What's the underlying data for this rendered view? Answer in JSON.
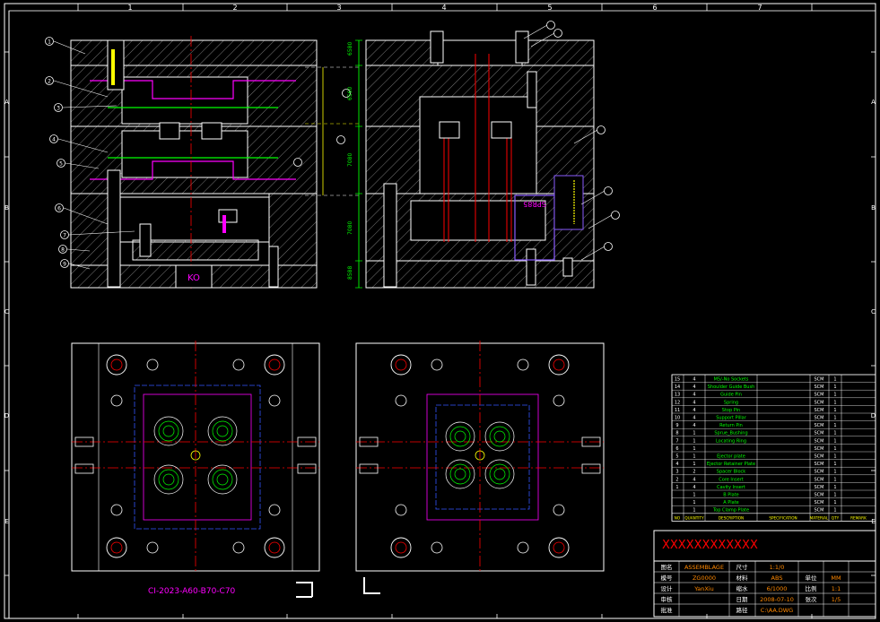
{
  "frame": {
    "col_numbers": [
      "1",
      "2",
      "3",
      "4",
      "5",
      "6",
      "7"
    ],
    "row_letters": [
      "A",
      "B",
      "C",
      "D",
      "E"
    ]
  },
  "top_view": {
    "numbered_balloons_left": [
      "1",
      "2",
      "3",
      "4",
      "5",
      "6",
      "7",
      "8",
      "9"
    ],
    "text_kd": "KO",
    "part_label": "SPR85"
  },
  "plan_label": "CI-2023-A60-B70-C70",
  "bom": {
    "rows": [
      {
        "no": "15",
        "qty": "4",
        "name": "M5/-No Sockets",
        "mat": "SCM",
        "n": "1"
      },
      {
        "no": "14",
        "qty": "4",
        "name": "Shoulder Guide Bush",
        "mat": "SCM",
        "n": "1"
      },
      {
        "no": "13",
        "qty": "4",
        "name": "Guide Pin",
        "mat": "SCM",
        "n": "1"
      },
      {
        "no": "12",
        "qty": "4",
        "name": "Spring",
        "mat": "SCM",
        "n": "1"
      },
      {
        "no": "11",
        "qty": "4",
        "name": "Stop Pin",
        "mat": "SCM",
        "n": "1"
      },
      {
        "no": "10",
        "qty": "4",
        "name": "Support Pillar",
        "mat": "SCM",
        "n": "1"
      },
      {
        "no": "9",
        "qty": "4",
        "name": "Return Pin",
        "mat": "SCM",
        "n": "1"
      },
      {
        "no": "8",
        "qty": "1",
        "name": "Sprue_Bushing",
        "mat": "SCM",
        "n": "1"
      },
      {
        "no": "7",
        "qty": "1",
        "name": "Locating Ring",
        "mat": "SCM",
        "n": "1"
      },
      {
        "no": "6",
        "qty": "1",
        "name": "",
        "mat": "SCM",
        "n": "1"
      },
      {
        "no": "5",
        "qty": "1",
        "name": "Ejector plate",
        "mat": "SCM",
        "n": "1"
      },
      {
        "no": "4",
        "qty": "1",
        "name": "Ejector Retainer Plate",
        "mat": "SCM",
        "n": "1"
      },
      {
        "no": "3",
        "qty": "2",
        "name": "Spacer Block",
        "mat": "SCM",
        "n": "1"
      },
      {
        "no": "2",
        "qty": "4",
        "name": "Core Insert",
        "mat": "SCM",
        "n": "1"
      },
      {
        "no": "1",
        "qty": "4",
        "name": "Cavity Insert",
        "mat": "SCM",
        "n": "1"
      },
      {
        "no": "",
        "qty": "1",
        "name": "B Plate",
        "mat": "SCM",
        "n": "1"
      },
      {
        "no": "",
        "qty": "1",
        "name": "A Plate",
        "mat": "SCM",
        "n": "1"
      },
      {
        "no": "",
        "qty": "1",
        "name": "Top Clamp Plate",
        "mat": "SCM",
        "n": "1"
      }
    ],
    "header": [
      "NO",
      "QUANTITY",
      "DESCRIPTION",
      "SPECIFICATION",
      "MATERIAL",
      "QTY",
      "REMARK"
    ]
  },
  "title_block": {
    "company": "XXXXXXXXXXXX",
    "r1": [
      "图名",
      "ASSEMBLAGE",
      "尺寸",
      "1:1/0"
    ],
    "r2": [
      "模号",
      "ZG0000",
      "材料",
      "ABS",
      "单位",
      "MM"
    ],
    "r3": [
      "设计",
      "YanXiu",
      "缩水",
      "6/1000",
      "比例",
      "1:1"
    ],
    "r4": [
      "审核",
      "",
      "日期",
      "2008-07-10",
      "张次",
      "1/5"
    ],
    "r5": [
      "批准",
      "",
      "路径",
      "C:\\AA.DWG"
    ]
  },
  "colors": {
    "bg": "#000000",
    "line": "#ffffff",
    "yellow": "#ffff00",
    "green": "#00ff00",
    "magenta": "#ff00ff",
    "red": "#ff0000",
    "cyan": "#00ffff",
    "blue": "#3355ff",
    "orange": "#ff8800"
  }
}
